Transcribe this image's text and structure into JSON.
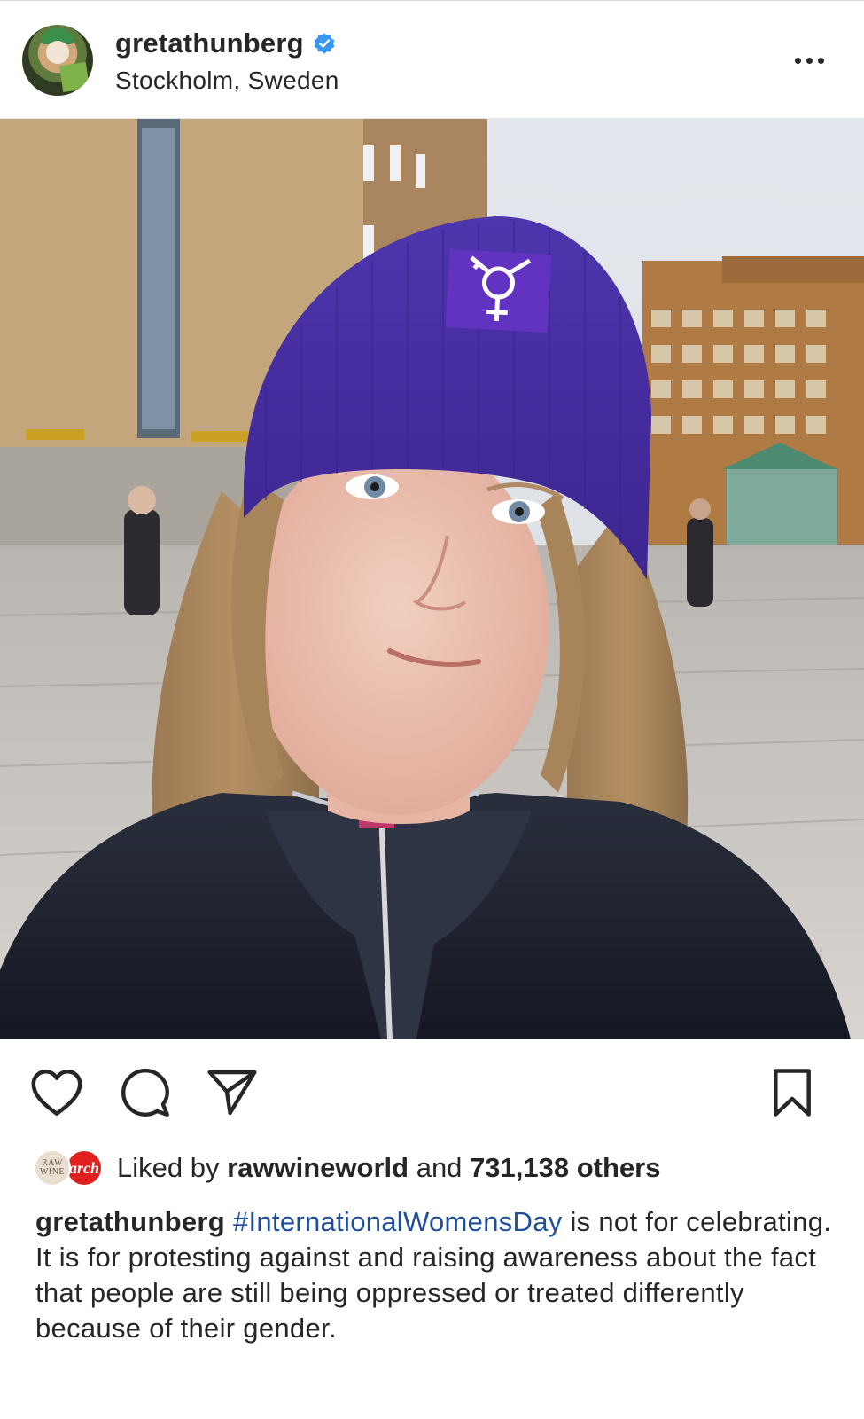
{
  "post": {
    "username": "gretathunberg",
    "verified": true,
    "location": "Stockholm, Sweden",
    "more_icon": "more-horizontal-icon",
    "image_alt": "Portrait of a young woman in a purple beanie with a feminist symbol patch, standing in a city square"
  },
  "actions": {
    "like_icon": "heart-outline-icon",
    "comment_icon": "comment-bubble-icon",
    "share_icon": "paper-plane-icon",
    "save_icon": "bookmark-outline-icon"
  },
  "likes": {
    "prefix": "Liked by",
    "liker": "rawwineworld",
    "connector": "and",
    "count_text": "731,138 others",
    "avatar1_text": "RAW WINE",
    "avatar2_text": "arch"
  },
  "caption": {
    "username": "gretathunberg",
    "hashtag": "#InternationalWomensDay",
    "text": " is not for celebrating. It is for protesting against and raising awareness about the fact that people are still being oppressed or treated differently because of their gender."
  },
  "colors": {
    "verified_blue": "#3897f0",
    "hashtag_blue": "#1f4f9a",
    "beanie_purple": "#4a2fa6",
    "text": "#262626"
  }
}
